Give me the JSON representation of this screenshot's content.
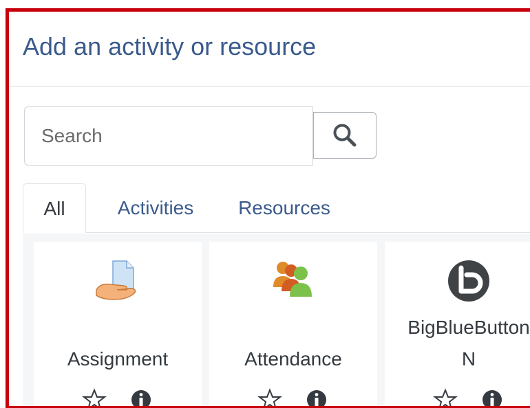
{
  "modal": {
    "title": "Add an activity or resource"
  },
  "search": {
    "placeholder": "Search"
  },
  "tabs": [
    {
      "label": "All",
      "active": true
    },
    {
      "label": "Activities",
      "active": false
    },
    {
      "label": "Resources",
      "active": false
    }
  ],
  "modules": [
    {
      "name": "Assignment",
      "icon": "assignment-icon"
    },
    {
      "name": "Attendance",
      "icon": "attendance-icon"
    },
    {
      "name": "BigBlueButtonBN",
      "name_line1": "BigBlueButton",
      "name_line2": "N",
      "icon": "bigbluebutton-icon"
    }
  ],
  "colors": {
    "frame": "#c8000a",
    "link": "#3a5a8c",
    "text": "#343a40"
  }
}
